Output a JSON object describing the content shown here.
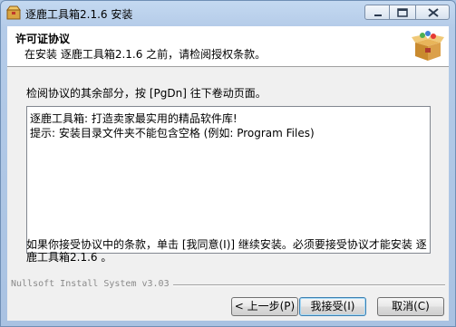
{
  "window": {
    "title": "逐鹿工具箱2.1.6 安装",
    "icon": "installer-box-icon"
  },
  "header": {
    "title": "许可证协议",
    "subtitle": "在安装 逐鹿工具箱2.1.6 之前，请检阅授权条款。",
    "icon": "open-box-icon"
  },
  "instruction": "检阅协议的其余部分，按 [PgDn] 往下卷动页面。",
  "license": {
    "lines": [
      "逐鹿工具箱: 打造卖家最实用的精品软件库!",
      "提示: 安装目录文件夹不能包含空格 (例如: Program Files)"
    ]
  },
  "accept_text": "如果你接受协议中的条款，单击 [我同意(I)] 继续安装。必须要接受协议才能安装 逐鹿工具箱2.1.6 。",
  "footer": {
    "branding": "Nullsoft Install System v3.03"
  },
  "buttons": {
    "back": "< 上一步(P)",
    "accept": "我接受(I)",
    "cancel": "取消(C)"
  },
  "colors": {
    "frame": "#a9c4e4",
    "client_bg": "#f0f0f0",
    "header_bg": "#ffffff"
  }
}
